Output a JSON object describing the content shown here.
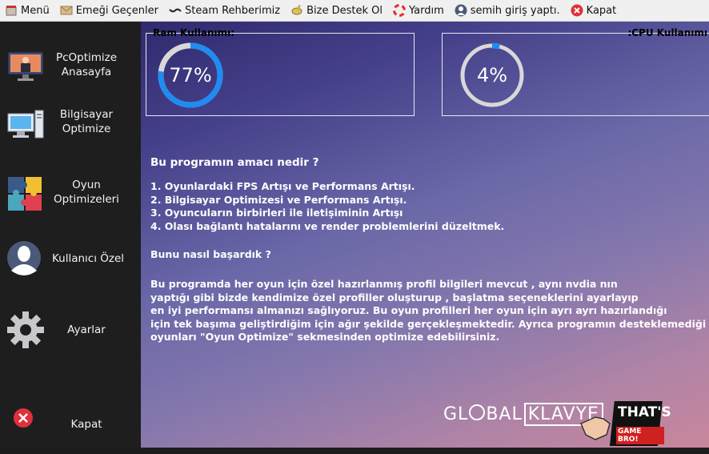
{
  "menubar": {
    "items": [
      {
        "label": "Menü",
        "icon": "menu-icon"
      },
      {
        "label": "Emeği Geçenler",
        "icon": "envelope-icon"
      },
      {
        "label": "Steam Rehberimiz",
        "icon": "steam-icon"
      },
      {
        "label": "Bize Destek Ol",
        "icon": "coin-icon"
      },
      {
        "label": "Yardım",
        "icon": "lifebuoy-icon"
      },
      {
        "label": "semih giriş yaptı.",
        "icon": "user-icon"
      },
      {
        "label": "Kapat",
        "icon": "close-icon"
      }
    ]
  },
  "sidebar": {
    "items": [
      {
        "label": "PcOptimize\nAnasayfa",
        "icon": "monitor-home-icon"
      },
      {
        "label": "Bilgisayar\nOptimize",
        "icon": "computer-icon"
      },
      {
        "label": "Oyun\nOptimizeleri",
        "icon": "puzzle-icon"
      },
      {
        "label": "Kullanıcı Özel",
        "icon": "user-avatar-icon"
      },
      {
        "label": "Ayarlar",
        "icon": "gear-icon"
      },
      {
        "label": "Kapat",
        "icon": "close-circle-icon"
      }
    ]
  },
  "gauges": {
    "ram": {
      "title": "Ram Kullanımı:",
      "value_text": "77%",
      "percent": 77,
      "color": "#1e8cf0"
    },
    "cpu": {
      "title": ":CPU Kullanımı",
      "value_text": "4%",
      "percent": 4,
      "color": "#1e8cf0"
    }
  },
  "content": {
    "heading1": "Bu programın amacı nedir ?",
    "list": [
      "1. Oyunlardaki FPS Artışı ve Performans Artışı.",
      "2. Bilgisayar Optimizesi ve Performans Artışı.",
      "3. Oyuncuların birbirleri ile iletişiminin Artışı",
      "4. Olası bağlantı hatalarını ve render problemlerini düzeltmek."
    ],
    "heading2": "Bunu nasıl başardık ?",
    "paragraph": [
      "Bu programda her oyun için özel hazırlanmış profil bilgileri mevcut , aynı nvdia nın",
      "yaptığı gibi bizde kendimize özel profiller oluşturup , başlatma seçeneklerini ayarlayıp",
      "en iyi performansı almanızı sağlıyoruz. Bu oyun profilleri her oyun için ayrı ayrı hazırlandığı",
      "için tek başıma geliştirdiğim için ağır şekilde gerçekleşmektedir. Ayrıca programın desteklemediği",
      "oyunları \"Oyun Optimize\" sekmesinden optimize edebilirsiniz."
    ]
  },
  "branding": {
    "logo1_a": "GL",
    "logo1_b": "BAL",
    "logo1_c": "KLAVYE",
    "logo2_line1": "THAT'S",
    "logo2_line2": "GAME BRO!"
  }
}
